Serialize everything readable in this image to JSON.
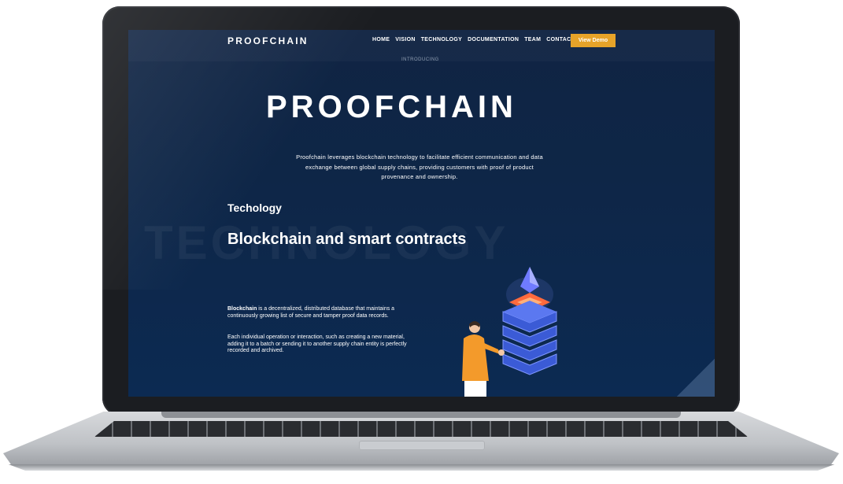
{
  "site": {
    "logo_small": "PROOFCHAIN",
    "nav": [
      "HOME",
      "VISION",
      "TECHNOLOGY",
      "DOCUMENTATION",
      "TEAM",
      "CONTACT"
    ],
    "demo_button": "View Demo",
    "introducing": "INTRODUCING",
    "hero_logo": "PROOFCHAIN",
    "hero_description": "Proofchain leverages blockchain technology to facilitate efficient communication and data exchange between global supply chains, providing customers with proof of product provenance and ownership.",
    "section_label": "Techology",
    "watermark": "TECHNOLOGY",
    "section_title": "Blockchain and smart contracts",
    "p1_bold": "Blockchain",
    "p1_rest": " is a decentralized, distributed database that maintains a continuously growing list of secure and tamper proof data records.",
    "p2": "Each individual operation or interaction, such as creating a new material, adding it to a batch or sending it to another supply chain entity is perfectly recorded and archived.",
    "colors": {
      "background": "#0e2647",
      "accent": "#e6a329",
      "text": "#ffffff"
    }
  }
}
